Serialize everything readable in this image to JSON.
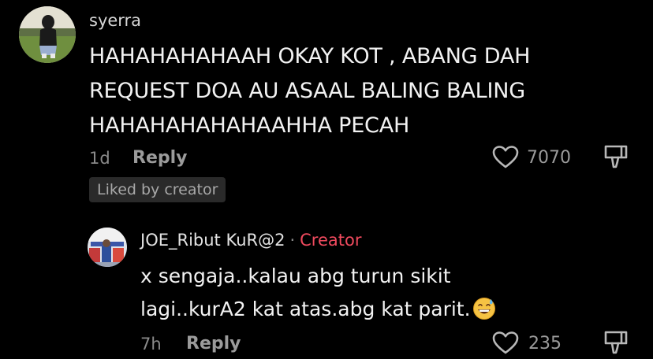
{
  "comment": {
    "username": "syerra",
    "text": "HAHAHAHAHAAH OKAY KOT , ABANG DAH REQUEST DOA AU ASAAL BALING BALING HAHAHAHAHAHAAHHA PECAH",
    "time": "1d",
    "reply_label": "Reply",
    "like_count": "7070",
    "badge": "Liked by creator"
  },
  "reply": {
    "username": "JOE_Ribut KuR@2",
    "separator": "·",
    "creator_label": "Creator",
    "text": "x sengaja..kalau abg turun sikit lagi..kurA2 kat atas.abg kat parit.",
    "emoji": "grinning-sweat-emoji",
    "time": "7h",
    "reply_label": "Reply",
    "like_count": "235"
  },
  "icons": {
    "like": "heart-outline-icon",
    "dislike": "thumbs-down-outline-icon"
  },
  "colors": {
    "background": "#000000",
    "creator_accent": "#f04a5e",
    "muted_text": "#8a8a8a",
    "badge_bg": "#2a2a2a"
  }
}
